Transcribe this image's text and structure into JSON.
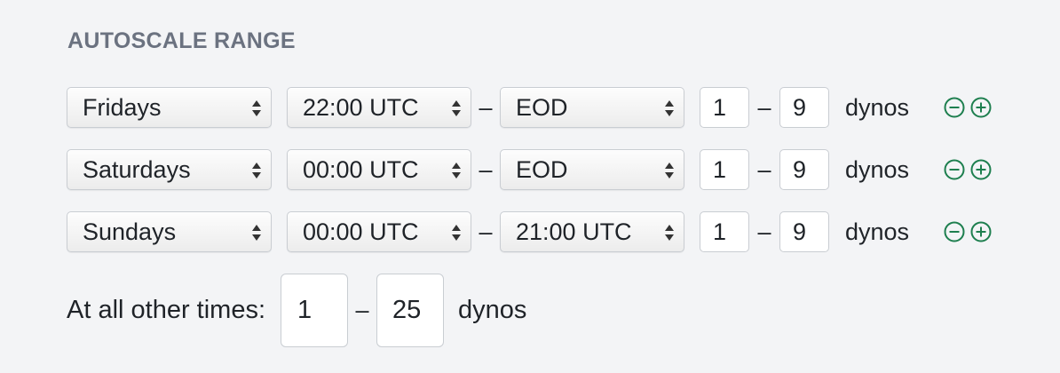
{
  "section": {
    "title": "AUTOSCALE RANGE"
  },
  "rows": [
    {
      "day": "Fridays",
      "start": "22:00 UTC",
      "end": "EOD",
      "min": "1",
      "max": "9",
      "unit": "dynos"
    },
    {
      "day": "Saturdays",
      "start": "00:00 UTC",
      "end": "EOD",
      "min": "1",
      "max": "9",
      "unit": "dynos"
    },
    {
      "day": "Sundays",
      "start": "00:00 UTC",
      "end": "21:00 UTC",
      "min": "1",
      "max": "9",
      "unit": "dynos"
    }
  ],
  "separator": "–",
  "default_range": {
    "label": "At all other times:",
    "min": "1",
    "max": "25",
    "unit": "dynos"
  },
  "icons": {
    "remove": "minus-circle-icon",
    "add": "plus-circle-icon",
    "select_arrows": "chevron-up-down-icon"
  },
  "colors": {
    "accent": "#1e7f4f",
    "background": "#f3f4f6",
    "heading": "#6b7280"
  }
}
